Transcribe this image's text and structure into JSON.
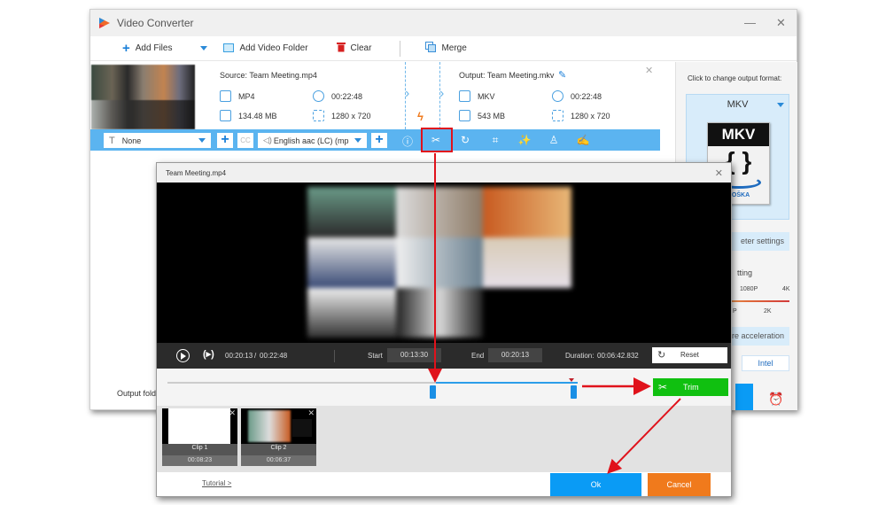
{
  "window": {
    "title": "Video Converter",
    "minimize_glyph": "—",
    "close_glyph": "✕"
  },
  "toolbar": {
    "add_files": "Add Files",
    "add_video_folder": "Add Video Folder",
    "clear": "Clear",
    "merge": "Merge"
  },
  "file_item": {
    "source_title": "Source: Team Meeting.mp4",
    "output_title": "Output: Team Meeting.mkv",
    "source": {
      "format": "MP4",
      "duration": "00:22:48",
      "size": "134.48 MB",
      "resolution": "1280 x 720"
    },
    "output": {
      "format": "MKV",
      "duration": "00:22:48",
      "size": "543 MB",
      "resolution": "1280 x 720"
    },
    "subtitle_select": "None",
    "audio_select": "English aac (LC) (mp",
    "cc_label": "CC"
  },
  "right_panel": {
    "label": "Click to change output format:",
    "format": "MKV",
    "format_logo_top": "MKV",
    "format_logo_word": "ROŠKA",
    "param_settings": "eter settings",
    "quality_label": "tting",
    "res_labels": [
      "1080P",
      "4K",
      "P",
      "2K"
    ],
    "hw_accel": "are acceleration",
    "intel": "Intel"
  },
  "output_folder_label": "Output folde",
  "trim_dialog": {
    "title": "Team Meeting.mp4",
    "current_time": "00:20:13",
    "total_time": "00:22:48",
    "time_separator": "/",
    "start_label": "Start",
    "start_value": "00:13:30",
    "end_label": "End",
    "end_value": "00:20:13",
    "duration_label": "Duration:",
    "duration_value": "00:06:42.832",
    "reset": "Reset",
    "trim": "Trim",
    "clips": [
      {
        "name": "Clip 1",
        "duration": "00:08:23"
      },
      {
        "name": "Clip 2",
        "duration": "00:06:37"
      }
    ],
    "tutorial": "Tutorial >",
    "ok": "Ok",
    "cancel": "Cancel"
  },
  "colors": {
    "accent_blue": "#5bb4f0",
    "ok_blue": "#0a9bf5",
    "trim_green": "#10c010",
    "cancel_orange": "#f07a1c",
    "annotation_red": "#e0121b"
  }
}
